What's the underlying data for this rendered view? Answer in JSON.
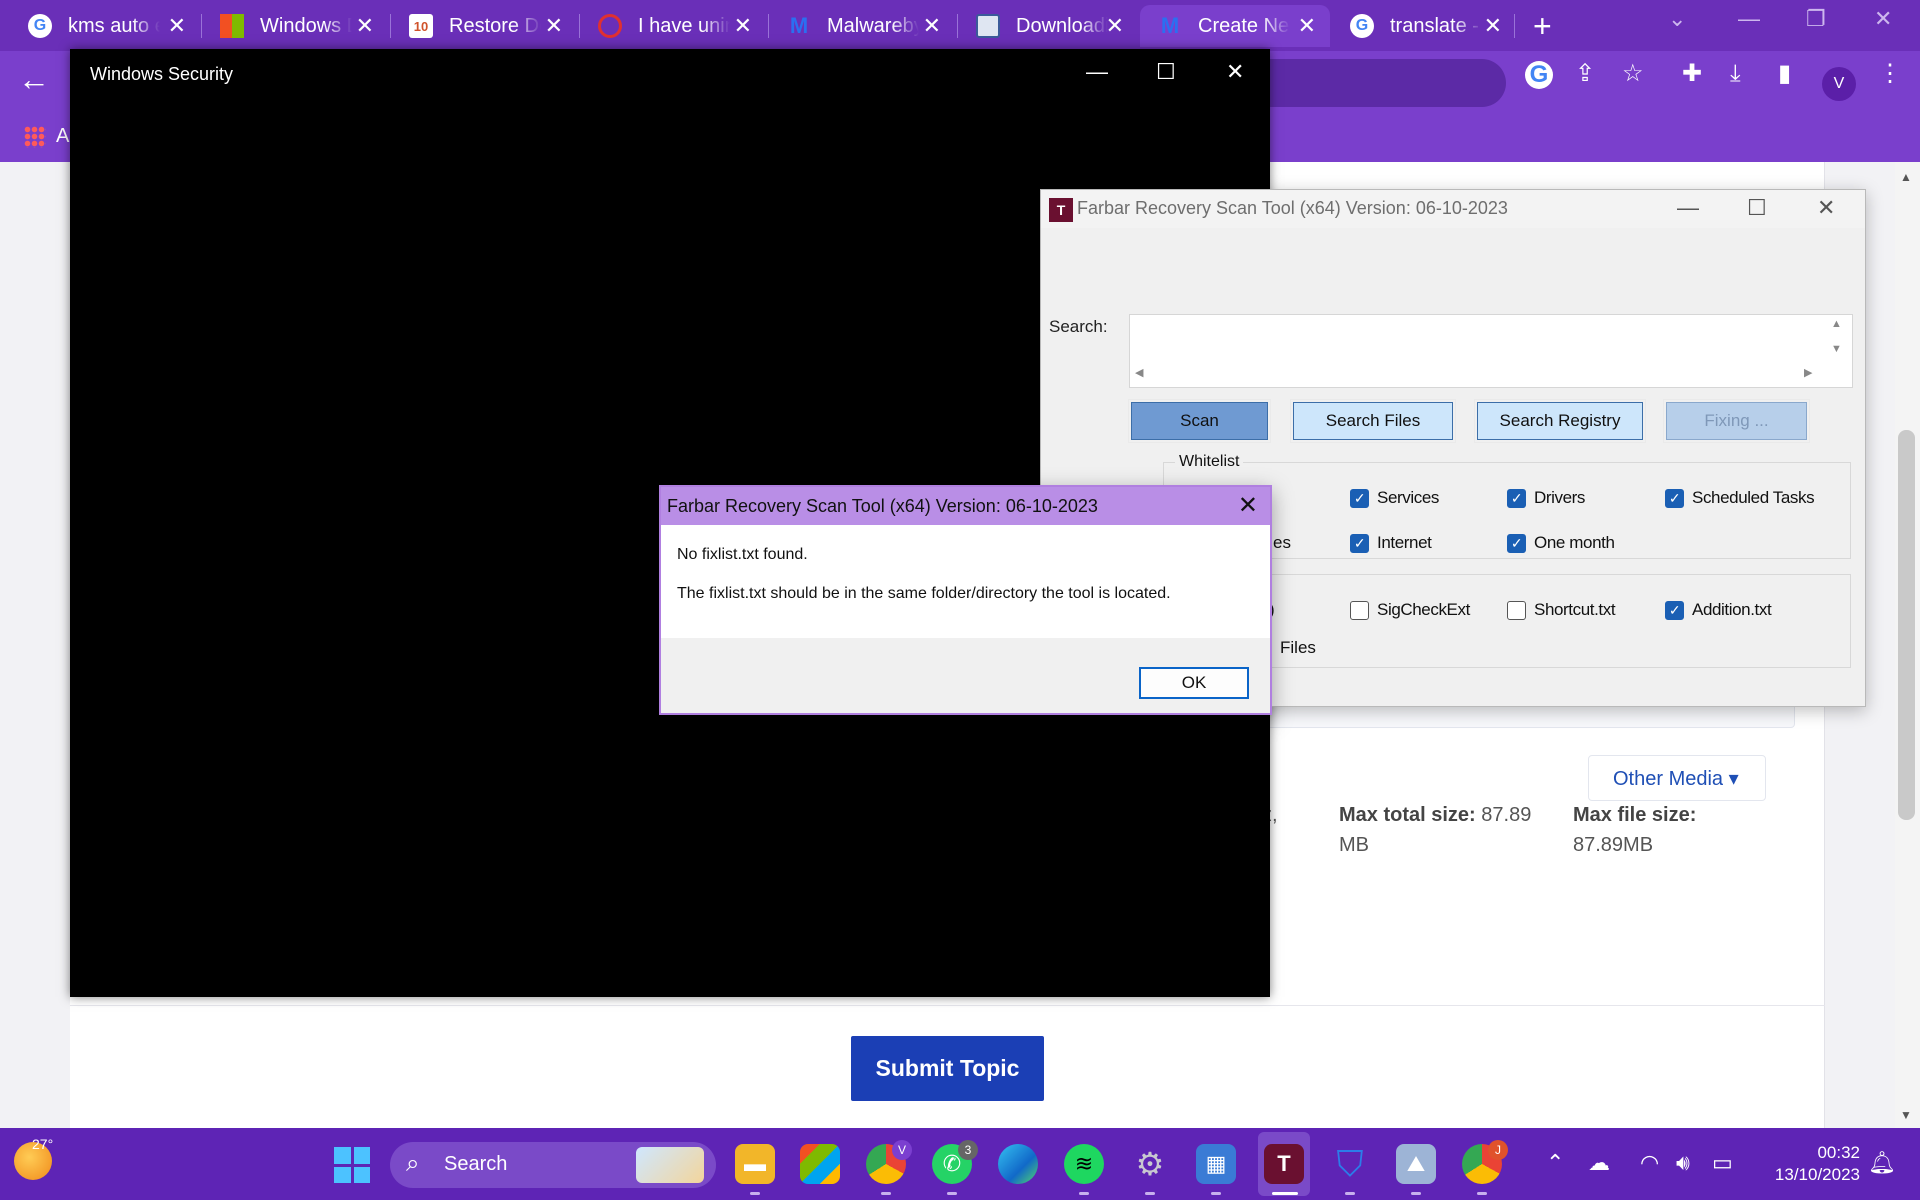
{
  "browser": {
    "tabs": [
      {
        "label": "kms auto e",
        "icon": "google-g"
      },
      {
        "label": "Windows D",
        "icon": "microsoft"
      },
      {
        "label": "Restore De",
        "icon": "windows-10"
      },
      {
        "label": "I have unin",
        "icon": "quora"
      },
      {
        "label": "Malwareby",
        "icon": "malwarebytes"
      },
      {
        "label": "Downloadi",
        "icon": "page"
      },
      {
        "label": "Create Nev",
        "icon": "malwarebytes",
        "active": true
      },
      {
        "label": "translate -",
        "icon": "google-g"
      }
    ],
    "profile_letter": "V",
    "bookmark_text": "A"
  },
  "page": {
    "other_media": "Other Media ▾",
    "fragment_left": "z,",
    "max_total_label": "Max total size:",
    "max_total_value": "87.89",
    "max_total_unit": "MB",
    "max_file_label": "Max file size:",
    "max_file_value": "87.89MB",
    "submit": "Submit Topic"
  },
  "winsec": {
    "title": "Windows Security"
  },
  "frst": {
    "title": "Farbar Recovery Scan Tool (x64) Version: 06-10-2023",
    "search_label": "Search:",
    "buttons": {
      "scan": "Scan",
      "search_files": "Search Files",
      "search_registry": "Search Registry",
      "fixing": "Fixing ..."
    },
    "whitelist_title": "Whitelist",
    "checks": {
      "services": "Services",
      "drivers": "Drivers",
      "scheduled_tasks": "Scheduled Tasks",
      "internet": "Internet",
      "one_month": "One month",
      "sigcheckext": "SigCheckExt",
      "shortcut": "Shortcut.txt",
      "addition": "Addition.txt"
    },
    "fragments": {
      "es": "es",
      "paren": ")",
      "files": "Files"
    }
  },
  "dialog": {
    "title": "Farbar Recovery Scan Tool (x64) Version: 06-10-2023",
    "line1": "No fixlist.txt found.",
    "line2": "The fixlist.txt should be in the same folder/directory the tool is located.",
    "ok": "OK"
  },
  "taskbar": {
    "temperature": "27°",
    "search": "Search",
    "chrome_badge": "V",
    "whatsapp_badge": "3",
    "chrome2_badge": "J",
    "time": "00:32",
    "date": "13/10/2023"
  },
  "colors": {
    "browser_frame": "#6a2fb8",
    "taskbar": "#5e24b5",
    "submit_button": "#1b3fb5",
    "dialog_titlebar": "#b98ee6",
    "checkbox_checked": "#1a5fb4"
  }
}
